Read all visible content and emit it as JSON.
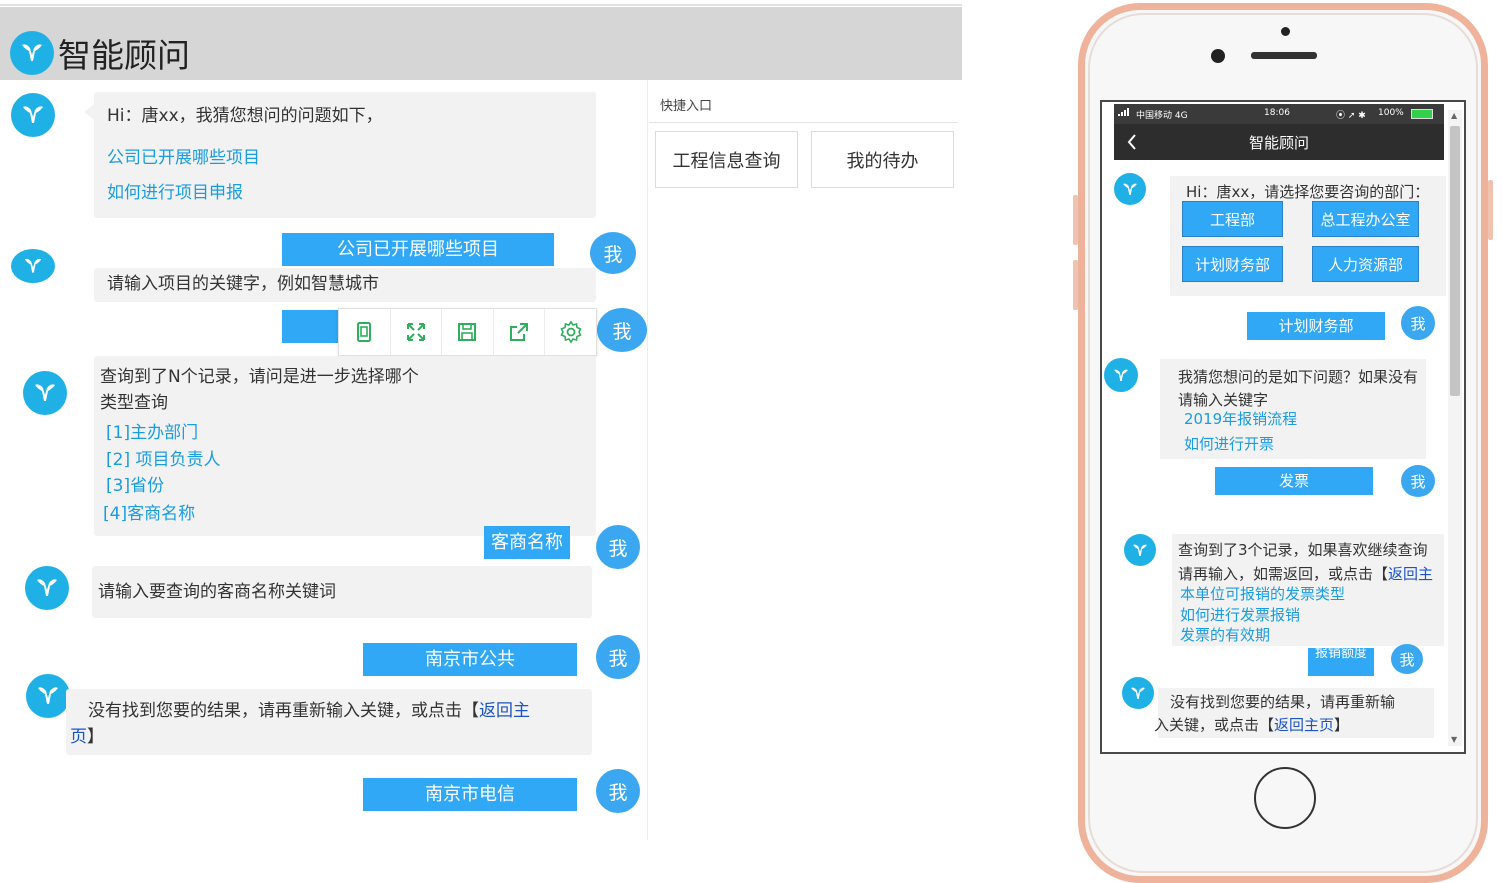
{
  "desktop": {
    "app_title": "智能顾问",
    "quick_entry": {
      "title": "快捷入口",
      "buttons": [
        "工程信息查询",
        "我的待办"
      ]
    },
    "messages": {
      "bot1": {
        "greeting": "Hi：唐xx，我猜您想问的问题如下，",
        "links": [
          "公司已开展哪些项目",
          "如何进行项目申报"
        ]
      },
      "user1": "公司已开展哪些项目",
      "bot2": "请输入项目的关键字，例如智慧城市",
      "bot3": {
        "text_line1": "查询到了N个记录，请问是进一步选择哪个",
        "text_line2": "类型查询",
        "options": [
          "[1]主办部门",
          "[2] 项目负责人",
          "[3]省份",
          "[4]客商名称"
        ]
      },
      "user3": "客商名称",
      "bot4": "请输入要查询的客商名称关键词",
      "user4": "南京市公共",
      "bot5": {
        "text": "没有找到您要的结果，请再重新输入关键，或点击【",
        "link_part1": "返回主",
        "link_part2": "页",
        "close": "】"
      },
      "user5": "南京市电信"
    },
    "me_label": "我",
    "toolbar_icons": [
      "tablet-icon",
      "fullscreen-icon",
      "save-icon",
      "share-icon",
      "settings-icon"
    ]
  },
  "phone": {
    "status": {
      "carrier": "中国移动  4G",
      "time": "18:06",
      "battery": "100%"
    },
    "nav_title": "智能顾问",
    "back_icon": "chevron-left-icon",
    "me_label": "我",
    "messages": {
      "bot1": {
        "text": "Hi：唐xx，请选择您要咨询的部门：",
        "departments": [
          "工程部",
          "总工程办公室",
          "计划财务部",
          "人力资源部"
        ]
      },
      "user1": "计划财务部",
      "bot2": {
        "line1": "我猜您想问的是如下问题？如果没有",
        "line2": "请输入关键字",
        "links": [
          "2019年报销流程",
          "如何进行开票"
        ]
      },
      "user2": "发票",
      "bot3": {
        "line1": "查询到了3个记录，如果喜欢继续查询",
        "line2_text": "请再输入，如需返回，或点击【",
        "line2_link": "返回主",
        "links": [
          "本单位可报销的发票类型",
          "如何进行发票报销",
          "发票的有效期"
        ]
      },
      "user3": "报销额度",
      "bot4": {
        "line1": "没有找到您要的结果，请再重新输",
        "line2_text": "入关键，或点击【",
        "line2_link": "返回主页",
        "line2_close": "】"
      }
    }
  },
  "colors": {
    "brand": "#1fb1e6",
    "user_bubble": "#30a8f5",
    "link": "#1a9de0",
    "toolbar_icon": "#2fae5e",
    "phone_frame": "#efb39c"
  }
}
